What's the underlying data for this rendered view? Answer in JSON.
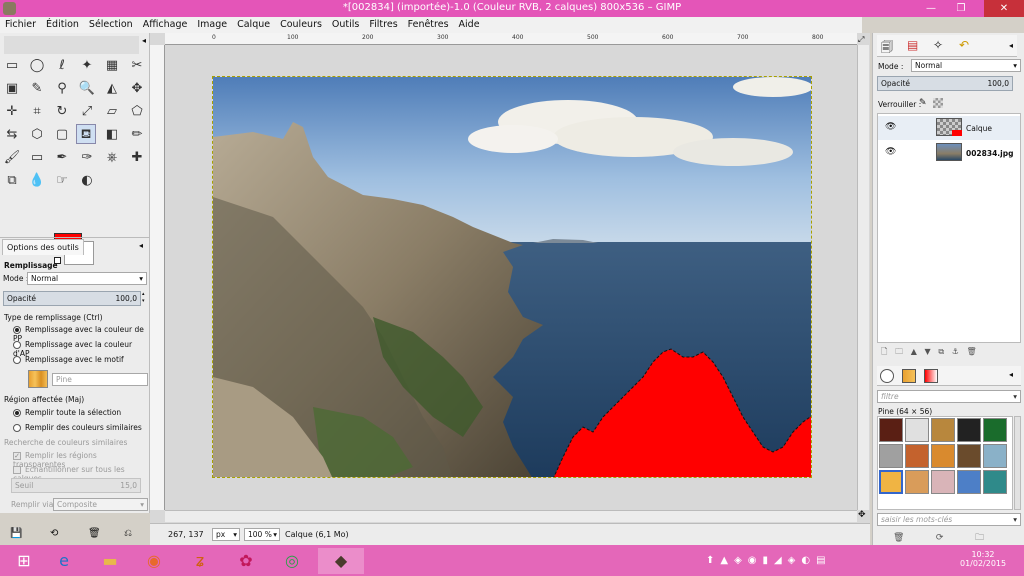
{
  "window": {
    "title": "*[002834] (importée)-1.0 (Couleur RVB, 2 calques) 800x536 – GIMP"
  },
  "menu": [
    "Fichier",
    "Édition",
    "Sélection",
    "Affichage",
    "Image",
    "Calque",
    "Couleurs",
    "Outils",
    "Filtres",
    "Fenêtres",
    "Aide"
  ],
  "toolbox": {
    "tools": [
      "rect-select",
      "ellipse-select",
      "free-select",
      "fuzzy-select",
      "by-color-select",
      "scissors-select",
      "foreground-select",
      "paths",
      "color-picker",
      "zoom",
      "measure",
      "move",
      "align",
      "crop",
      "rotate",
      "scale",
      "shear",
      "perspective",
      "flip",
      "cage",
      "unified-transform",
      "text",
      "bucket-fill",
      "blend",
      "pencil",
      "paintbrush",
      "eraser",
      "airbrush",
      "ink",
      "clone",
      "heal",
      "perspective-clone",
      "blur",
      "smudge",
      "dodge-burn"
    ],
    "fg_color": "#ff0000",
    "bg_color": "#ffffff"
  },
  "tool_options": {
    "tab_label": "Options des outils",
    "section": "Remplissage",
    "mode_label": "Mode :",
    "mode_value": "Normal",
    "opacity_label": "Opacité",
    "opacity_value": "100,0",
    "fill_type_label": "Type de remplissage (Ctrl)",
    "fill_options": [
      "Remplissage avec la couleur de PP",
      "Remplissage avec la couleur d'AP",
      "Remplissage avec le motif"
    ],
    "fill_selected": 0,
    "pattern_name": "Pine",
    "region_label": "Région affectée (Maj)",
    "region_options": [
      "Remplir toute la sélection",
      "Remplir des couleurs similaires"
    ],
    "region_selected": 0,
    "similar_label": "Recherche de couleurs similaires",
    "transparent_label": "Remplir les régions transparentes",
    "sample_label": "Échantillonner sur tous les calques",
    "threshold_label": "Seuil",
    "threshold_value": "15,0",
    "fill_by_label": "Remplir via",
    "fill_by_value": "Composite"
  },
  "rulers": {
    "x": [
      "0",
      "100",
      "200",
      "300",
      "400",
      "500",
      "600",
      "700",
      "800"
    ]
  },
  "status": {
    "coords": "267, 137",
    "unit": "px",
    "zoom": "100 %",
    "layer": "Calque (6,1 Mo)"
  },
  "layers_panel": {
    "mode_label": "Mode :",
    "mode_value": "Normal",
    "opacity_label": "Opacité",
    "opacity_value": "100,0",
    "lock_label": "Verrouiller :",
    "layers": [
      {
        "name": "Calque",
        "active": true
      },
      {
        "name": "002834.jpg",
        "active": false
      }
    ]
  },
  "patterns_panel": {
    "filter_placeholder": "filtre",
    "pattern_title": "Pine (64 × 56)",
    "tags_placeholder": "saisir les mots-clés"
  },
  "taskbar": {
    "time": "10:32",
    "date": "01/02/2015",
    "apps": [
      "windows-start",
      "internet-explorer",
      "file-explorer",
      "firefox",
      "app-4",
      "app-5",
      "chrome",
      "gimp"
    ]
  },
  "colors": {
    "titlebar": "#e455b8",
    "taskbar": "#e467b9",
    "fill_red": "#ff0000"
  }
}
